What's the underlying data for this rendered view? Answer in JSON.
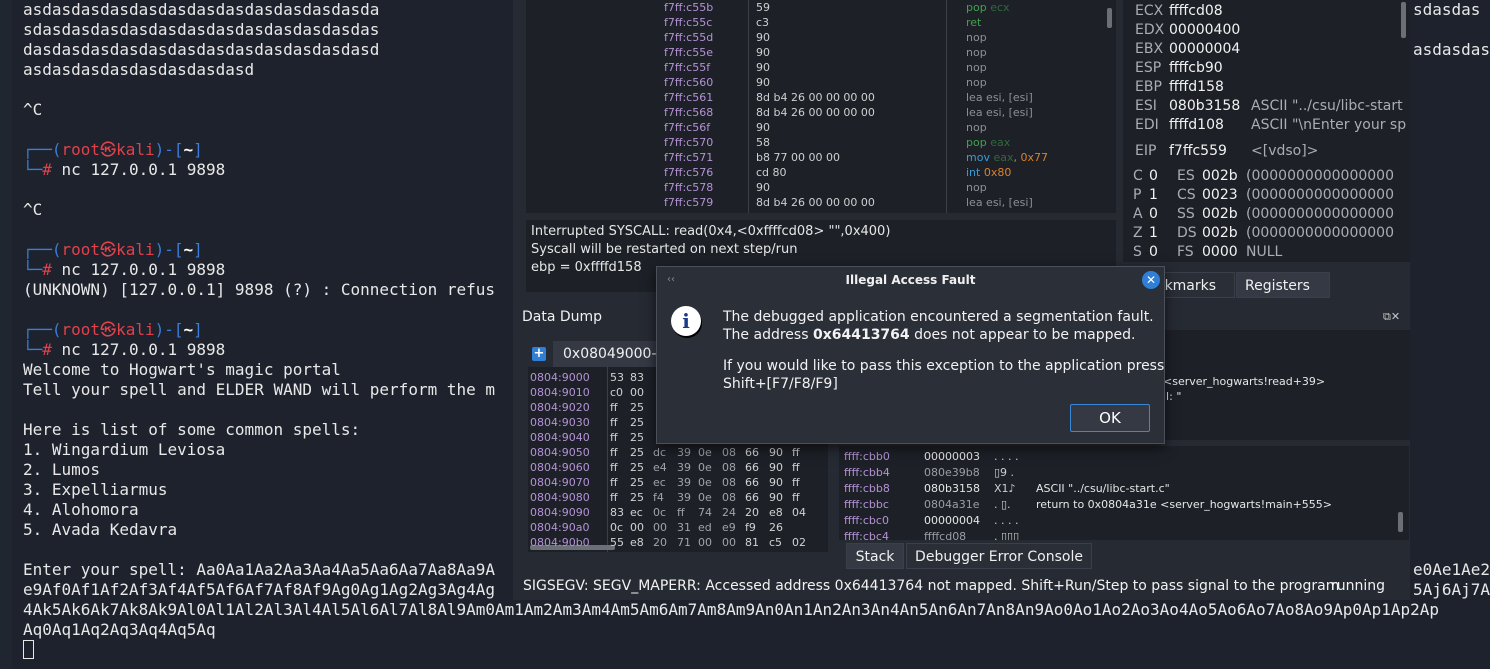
{
  "terminal": {
    "lines": [
      "asdasdasdasdasdasdasdasdasdasdasdasda",
      "sdasdasdasdasdasdasdasdasdasdasdasdas",
      "dasdasdasdasdasdasdasdasdasdasdasdasd",
      "asdasdasdasdasdasdasdasd",
      "",
      "^C",
      "",
      "",
      "",
      "^C",
      "",
      "",
      "",
      "(UNKNOWN) [127.0.0.1] 9898 (?) : Connection refus",
      "",
      "",
      "",
      "",
      "Welcome to Hogwart's magic portal",
      "Tell your spell and ELDER WAND will perform the m",
      "",
      "Here is list of some common spells:",
      "1. Wingardium Leviosa",
      "2. Lumos",
      "3. Expelliarmus",
      "4. Alohomora",
      "5. Avada Kedavra",
      "",
      "Enter your spell: Aa0Aa1Aa2Aa3Aa4Aa5Aa6Aa7Aa8Aa9A",
      "e9Af0Af1Af2Af3Af4Af5Af6Af7Af8Af9Ag0Ag1Ag2Ag3Ag4Ag",
      "4Ak5Ak6Ak7Ak8Ak9Al0Al1Al2Al3Al4Al5Al6Al7Al8Al9Am0Am1Am2Am3Am4Am5Am6Am7Am8Am9An0An1An2An3An4An5An6An7An8An9Ao0Ao1Ao2Ao3Ao4Ao5Ao6Ao7Ao8Ao9Ap0Ap1Ap2Ap",
      "Aq0Aq1Aq2Aq3Aq4Aq5Aq"
    ],
    "prompt_user": "root",
    "prompt_at": "㉿",
    "prompt_host": "kali",
    "prompt_dir": "~",
    "prompt_symbol": "#",
    "command": "nc 127.0.0.1 9898",
    "right_lines": [
      "sdasdas",
      "",
      "asdasdas"
    ],
    "right_lines_lower": [
      "e0Ae1Ae2",
      "5Aj6Aj7A"
    ]
  },
  "cpu": {
    "rows": [
      {
        "addr": "f7ff:c55b",
        "bytes": "59",
        "mn": "pop",
        "ops": "ecx",
        "kind": "pop"
      },
      {
        "addr": "f7ff:c55c",
        "bytes": "c3",
        "mn": "ret",
        "ops": "",
        "kind": "ret"
      },
      {
        "addr": "f7ff:c55d",
        "bytes": "90",
        "mn": "nop",
        "ops": "",
        "kind": "nop"
      },
      {
        "addr": "f7ff:c55e",
        "bytes": "90",
        "mn": "nop",
        "ops": "",
        "kind": "nop"
      },
      {
        "addr": "f7ff:c55f",
        "bytes": "90",
        "mn": "nop",
        "ops": "",
        "kind": "nop"
      },
      {
        "addr": "f7ff:c560",
        "bytes": "90",
        "mn": "nop",
        "ops": "",
        "kind": "nop"
      },
      {
        "addr": "f7ff:c561",
        "bytes": "8d b4 26 00 00 00 00",
        "mn": "lea esi, [esi]",
        "ops": "",
        "kind": "nop"
      },
      {
        "addr": "f7ff:c568",
        "bytes": "8d b4 26 00 00 00 00",
        "mn": "lea esi, [esi]",
        "ops": "",
        "kind": "nop"
      },
      {
        "addr": "f7ff:c56f",
        "bytes": "90",
        "mn": "nop",
        "ops": "",
        "kind": "nop"
      },
      {
        "addr": "f7ff:c570",
        "bytes": "58",
        "mn": "pop",
        "ops": "eax",
        "kind": "pop"
      },
      {
        "addr": "f7ff:c571",
        "bytes": "b8 77 00 00 00",
        "mn": "mov",
        "ops": "eax",
        "imm": ", 0x77",
        "kind": "mov"
      },
      {
        "addr": "f7ff:c576",
        "bytes": "cd 80",
        "mn": "int",
        "ops": "",
        "imm": " 0x80",
        "kind": "int"
      },
      {
        "addr": "f7ff:c578",
        "bytes": "90",
        "mn": "nop",
        "ops": "",
        "kind": "nop"
      },
      {
        "addr": "f7ff:c579",
        "bytes": "8d b4 26 00 00 00 00",
        "mn": "lea esi, [esi]",
        "ops": "",
        "kind": "nop"
      }
    ]
  },
  "info": {
    "lines": [
      "Interrupted SYSCALL: read(0x4,<0xffffcd08> \"\",0x400)",
      "Syscall will be restarted on next step/run",
      "ebp = 0xffffd158"
    ]
  },
  "registers": {
    "gprs": [
      {
        "n": "ECX",
        "v": "ffffcd08",
        "c": ""
      },
      {
        "n": "EDX",
        "v": "00000400",
        "c": ""
      },
      {
        "n": "EBX",
        "v": "00000004",
        "c": ""
      },
      {
        "n": "ESP",
        "v": "ffffcb90",
        "c": ""
      },
      {
        "n": "EBP",
        "v": "ffffd158",
        "c": ""
      },
      {
        "n": "ESI",
        "v": "080b3158",
        "c": "ASCII \"../csu/libc-start"
      },
      {
        "n": "EDI",
        "v": "ffffd108",
        "c": "ASCII \"\\nEnter your sp"
      }
    ],
    "eip": {
      "n": "EIP",
      "v": "f7ffc559",
      "c": "<[vdso]>"
    },
    "flags": [
      {
        "f": "C",
        "fv": "0",
        "s": "ES",
        "sv": "002b",
        "d": "(0000000000000000"
      },
      {
        "f": "P",
        "fv": "1",
        "s": "CS",
        "sv": "0023",
        "d": "(0000000000000000"
      },
      {
        "f": "A",
        "fv": "0",
        "s": "SS",
        "sv": "002b",
        "d": "(0000000000000000"
      },
      {
        "f": "Z",
        "fv": "1",
        "s": "DS",
        "sv": "002b",
        "d": "(0000000000000000"
      },
      {
        "f": "S",
        "fv": "0",
        "s": "FS",
        "sv": "0000",
        "d": "NULL"
      }
    ]
  },
  "tabs": {
    "bookmarks": "okmarks",
    "registers": "Registers",
    "stack": "Stack",
    "error_console": "Debugger Error Console"
  },
  "data_dump": {
    "title": "Data Dump",
    "tab": "0x08049000-",
    "rows": [
      {
        "a": "0804:9000",
        "b": [
          "53",
          "83",
          "",
          "",
          "",
          "",
          "",
          ""
        ]
      },
      {
        "a": "0804:9010",
        "b": [
          "c0",
          "00",
          "",
          "",
          "",
          "",
          "",
          ""
        ]
      },
      {
        "a": "0804:9020",
        "b": [
          "ff",
          "25",
          "",
          "",
          "",
          "",
          "",
          ""
        ]
      },
      {
        "a": "0804:9030",
        "b": [
          "ff",
          "25",
          "",
          "",
          "",
          "",
          "",
          ""
        ]
      },
      {
        "a": "0804:9040",
        "b": [
          "ff",
          "25",
          "",
          "",
          "",
          "",
          "",
          ""
        ]
      },
      {
        "a": "0804:9050",
        "b": [
          "ff",
          "25",
          "dc",
          "39",
          "0e",
          "08",
          "66",
          "90",
          "ff"
        ]
      },
      {
        "a": "0804:9060",
        "b": [
          "ff",
          "25",
          "e4",
          "39",
          "0e",
          "08",
          "66",
          "90",
          "ff"
        ]
      },
      {
        "a": "0804:9070",
        "b": [
          "ff",
          "25",
          "ec",
          "39",
          "0e",
          "08",
          "66",
          "90",
          "ff"
        ]
      },
      {
        "a": "0804:9080",
        "b": [
          "ff",
          "25",
          "f4",
          "39",
          "0e",
          "08",
          "66",
          "90",
          "ff"
        ]
      },
      {
        "a": "0804:9090",
        "b": [
          "83",
          "ec",
          "0c",
          "ff",
          "74",
          "24",
          "20",
          "e8",
          "04"
        ]
      },
      {
        "a": "0804:90a0",
        "b": [
          "0c",
          "00",
          "00",
          "31",
          "ed",
          "e9",
          "f9",
          "26"
        ]
      },
      {
        "a": "0804:90b0",
        "b": [
          "55",
          "e8",
          "20",
          "71",
          "00",
          "00",
          "81",
          "c5",
          "02"
        ]
      }
    ]
  },
  "lower_right": {
    "lines": [
      "<server_hogwarts!read+39>",
      "ll: \""
    ]
  },
  "stack": {
    "rows": [
      {
        "a": "ffff:cbb0",
        "v": "00000003",
        "c": ". . . .",
        "m": "",
        "dim": false
      },
      {
        "a": "ffff:cbb4",
        "v": "080e39b8",
        "c": "▯9 .",
        "m": "",
        "dim": true
      },
      {
        "a": "ffff:cbb8",
        "v": "080b3158",
        "c": "X1♪",
        "m": "ASCII \"../csu/libc-start.c\"",
        "dim": false
      },
      {
        "a": "ffff:cbbc",
        "v": "0804a31e",
        "c": ". ▯.",
        "m": "return to 0x0804a31e <server_hogwarts!main+555>",
        "dim": true
      },
      {
        "a": "ffff:cbc0",
        "v": "00000004",
        "c": ". . . .",
        "m": "",
        "dim": false
      },
      {
        "a": "ffff:cbc4",
        "v": "ffffcd08",
        "c": ". ▯▯▯",
        "m": "",
        "dim": true
      }
    ]
  },
  "status": {
    "message": "SIGSEGV: SEGV_MAPERR: Accessed address 0x64413764 not mapped. Shift+Run/Step to pass signal to the program",
    "state": "running"
  },
  "dialog": {
    "title": "Illegal Access Fault",
    "line1": "The debugged application encountered a segmentation fault.",
    "line2_pre": "The address ",
    "line2_addr": "0x64413764",
    "line2_post": " does not appear to be mapped.",
    "line3": "If you would like to pass this exception to the application press",
    "line4": "Shift+[F7/F8/F9]",
    "ok_label": "OK"
  }
}
